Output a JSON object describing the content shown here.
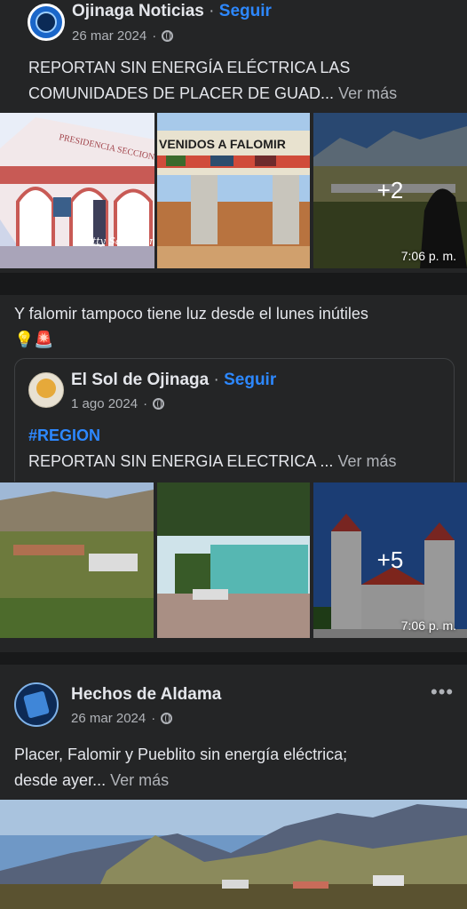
{
  "post1": {
    "page_name": "Ojinaga Noticias",
    "separator": " · ",
    "follow": "Seguir",
    "date": "26 mar 2024",
    "date_sep": "·",
    "text": "REPORTAN SIN ENERGÍA ELÉCTRICA LAS COMUNIDADES DE PLACER DE GUAD...",
    "see_more": "Ver más",
    "photo1_watermark": "Letty Santellan",
    "photo1_sign": "PRESIDENCIA SECCIONAL PLACER DE GUADALUPE",
    "photo2_sign": "VENIDOS A FALOMIR",
    "extra_count": "+2",
    "time": "7:06 p. m."
  },
  "post2": {
    "comment": "Y falomir tampoco tiene luz desde el lunes inútiles",
    "emojis": "💡🚨",
    "shared": {
      "page_name": "El Sol de Ojinaga",
      "separator": " · ",
      "follow": "Seguir",
      "date": "1 ago 2024",
      "date_sep": "·",
      "hashtag": "#REGION",
      "text": "REPORTAN SIN ENERGIA ELECTRICA ...",
      "see_more": "Ver más"
    },
    "extra_count": "+5",
    "time": "7:06 p. m."
  },
  "post3": {
    "page_name": "Hechos de Aldama",
    "date": "26 mar 2024",
    "date_sep": "·",
    "text_line1": "Placer, Falomir y Pueblito sin energía eléctrica;",
    "text_line2": "desde ayer...",
    "see_more": "Ver más",
    "menu": "•••"
  },
  "colors": {
    "background": "#18191a",
    "card": "#242526",
    "accent": "#2d88ff",
    "text": "#e4e6eb",
    "secondary": "#b0b3b8"
  }
}
